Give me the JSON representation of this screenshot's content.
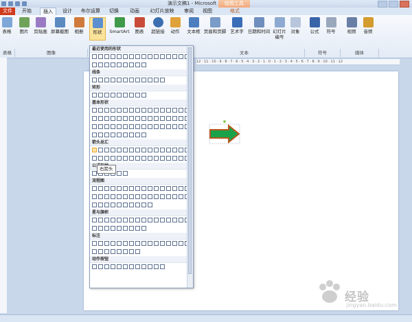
{
  "window": {
    "title": "演示文稿1 - Microsoft PowerPoint",
    "context_group": "绘图工具"
  },
  "tabs": [
    {
      "label": "文件"
    },
    {
      "label": "开始"
    },
    {
      "label": "插入"
    },
    {
      "label": "设计"
    },
    {
      "label": "布尔运算"
    },
    {
      "label": "切换"
    },
    {
      "label": "动画"
    },
    {
      "label": "幻灯片放映"
    },
    {
      "label": "审阅"
    },
    {
      "label": "视图"
    },
    {
      "label": "格式"
    }
  ],
  "ribbon": {
    "buttons": [
      {
        "label": "表格"
      },
      {
        "label": "图片"
      },
      {
        "label": "剪贴画"
      },
      {
        "label": "屏幕截图"
      },
      {
        "label": "相册"
      },
      {
        "label": "形状"
      },
      {
        "label": "SmartArt"
      },
      {
        "label": "图表"
      },
      {
        "label": "超链接"
      },
      {
        "label": "动作"
      },
      {
        "label": "文本框"
      },
      {
        "label": "页眉和页脚"
      },
      {
        "label": "艺术字"
      },
      {
        "label": "日期和时间"
      },
      {
        "label": "幻灯片编号"
      },
      {
        "label": "对象"
      },
      {
        "label": "公式"
      },
      {
        "label": "符号"
      },
      {
        "label": "视频"
      },
      {
        "label": "音频"
      }
    ],
    "groups": [
      {
        "label": "表格"
      },
      {
        "label": "图像"
      },
      {
        "label": "文本"
      },
      {
        "label": "符号"
      },
      {
        "label": "媒体"
      }
    ],
    "colors": {
      "file_tab": "#cf3a1c",
      "selected_button": "#fbe39a"
    }
  },
  "ruler": {
    "labels": "12 · 11 · 10 · 9 · 8 · 7 · 6 · 5 · 4 · 3 · 2 · 1 · 0 · 1 · 2 · 3 · 4 · 5 · 6 · 7 · 8 · 9 · 10 · 11 · 12"
  },
  "shapes_panel": {
    "sections": [
      {
        "label": "最近使用的形状",
        "rows": [
          16,
          9
        ]
      },
      {
        "label": "线条",
        "rows": [
          12
        ]
      },
      {
        "label": "矩形",
        "rows": [
          9
        ]
      },
      {
        "label": "基本形状",
        "rows": [
          16,
          16,
          16,
          9
        ]
      },
      {
        "label": "箭头总汇",
        "rows": [
          16,
          16
        ]
      },
      {
        "label": "公式形状",
        "rows": [
          6
        ]
      },
      {
        "label": "流程图",
        "rows": [
          16,
          16,
          10
        ]
      },
      {
        "label": "星与旗帜",
        "rows": [
          16,
          9
        ]
      },
      {
        "label": "标注",
        "rows": [
          16,
          8
        ]
      },
      {
        "label": "动作按钮",
        "rows": [
          12
        ]
      }
    ],
    "highlighted_shape": "right-arrow-icon",
    "tooltip": "右箭头"
  },
  "slide": {
    "shape": {
      "icon": "right-arrow-icon",
      "fill": "#1aa24a",
      "outline": "#b8581f"
    }
  },
  "watermark": {
    "text": "经验",
    "url": "jingyan.baidu.com"
  }
}
